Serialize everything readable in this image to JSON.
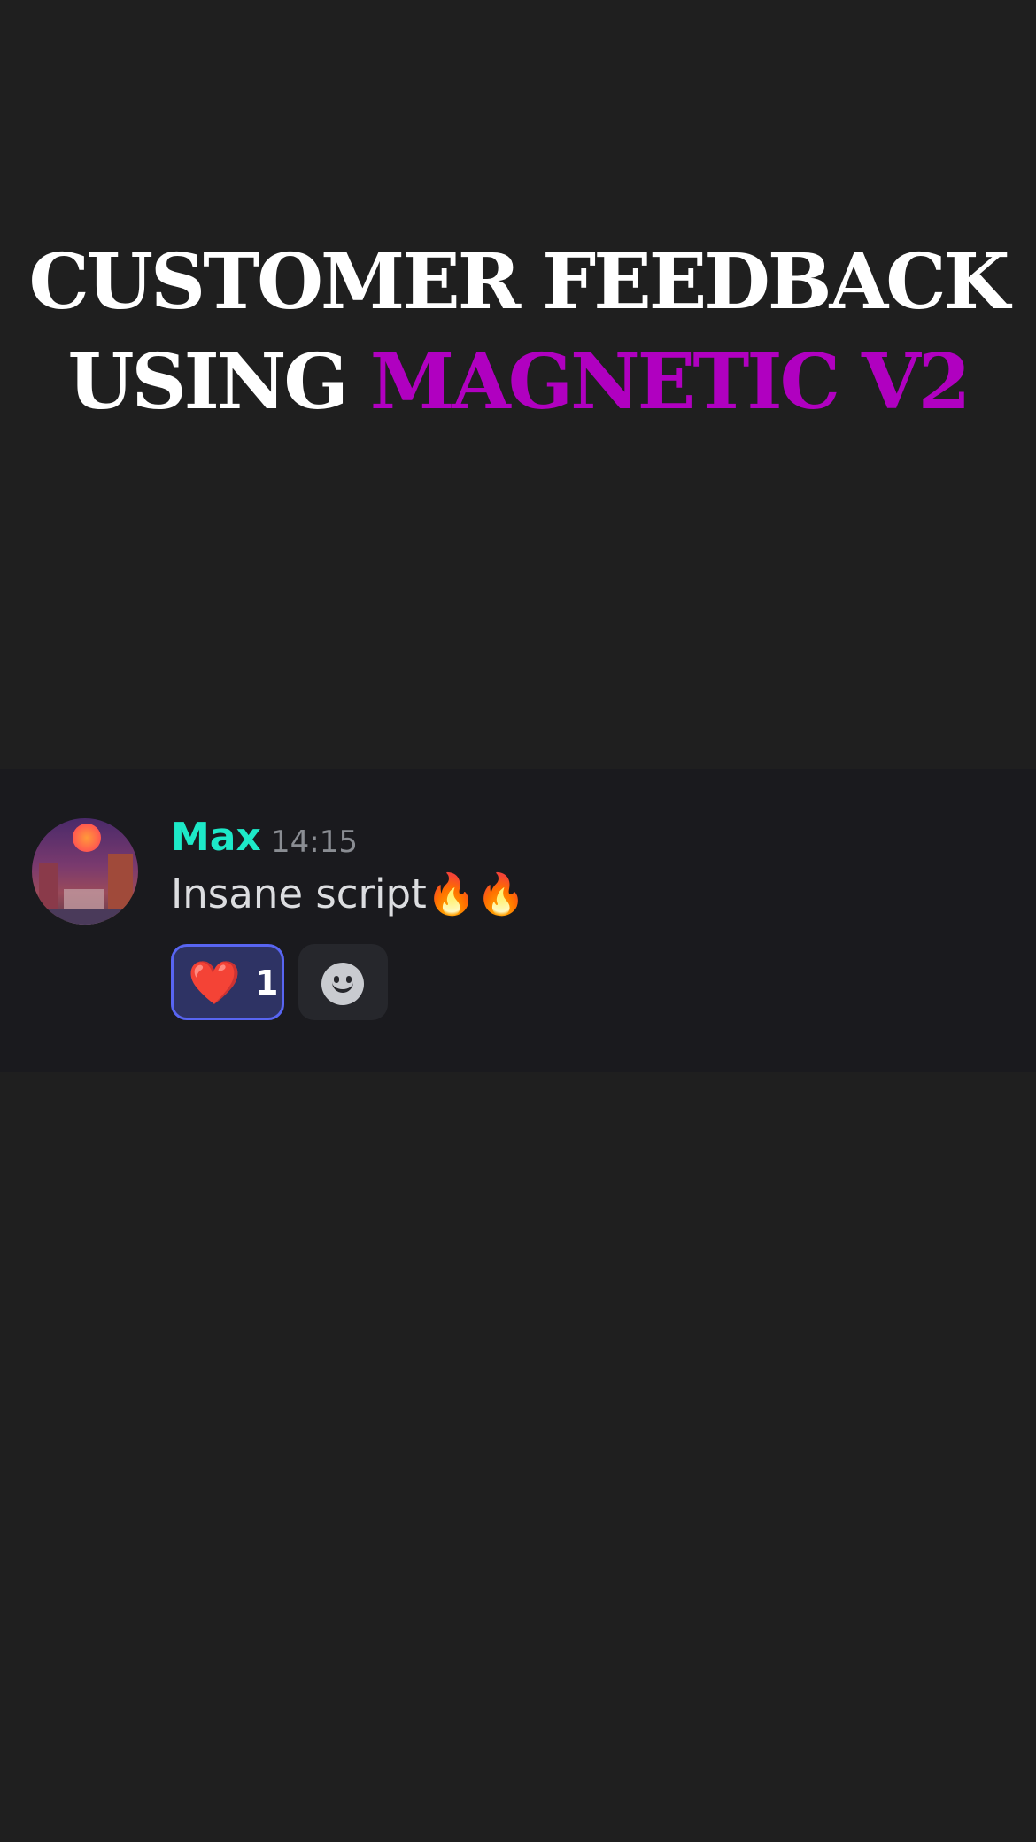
{
  "headline": {
    "line1": "CUSTOMER FEEDBACK",
    "line2_prefix": "USING ",
    "line2_accent": "MAGNETIC V2",
    "accent_color": "#b000c0"
  },
  "message": {
    "username": "Max",
    "username_color": "#1de9c8",
    "timestamp": "14:15",
    "text": "Insane script🔥🔥",
    "avatar_icon": "avatar-sunset-city",
    "reactions": [
      {
        "emoji": "❤️",
        "icon": "heart-icon",
        "count": "1",
        "selected": true
      }
    ],
    "add_reaction_icon": "smiley-icon"
  }
}
